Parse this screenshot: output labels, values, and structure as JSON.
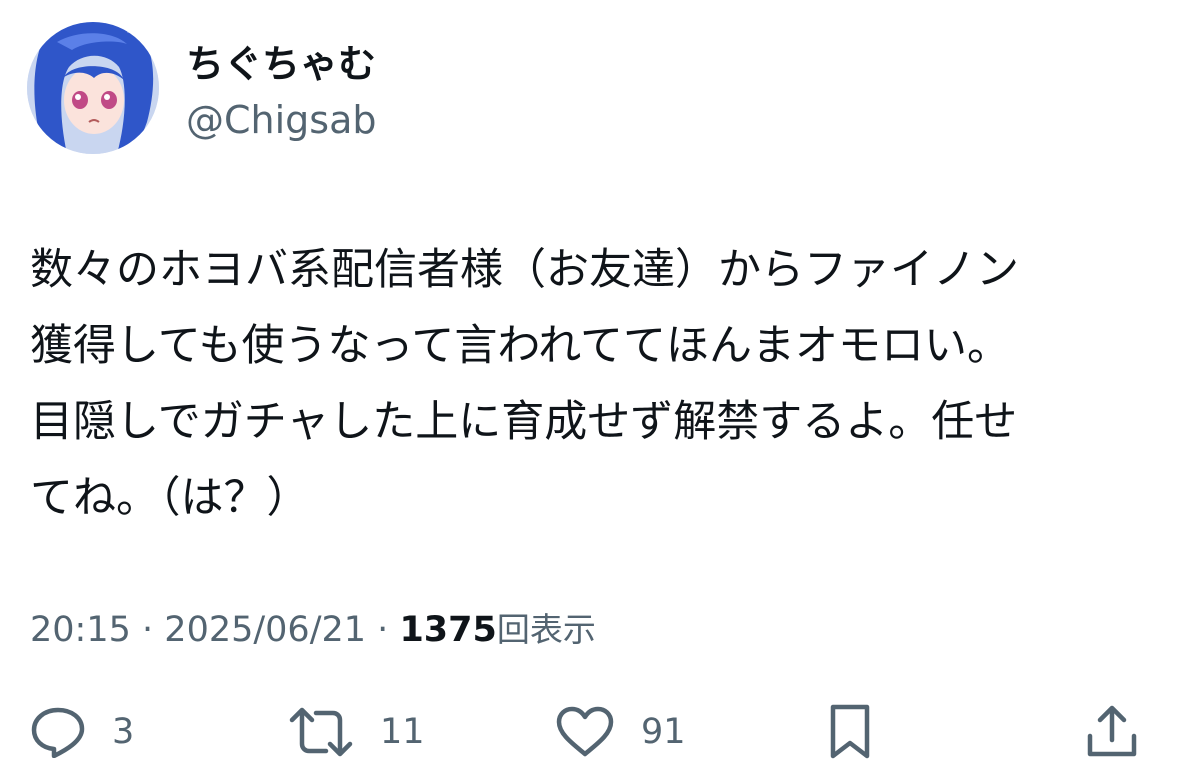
{
  "user": {
    "display_name": "ちぐちゃむ",
    "handle": "@Chigsab"
  },
  "tweet": {
    "lines": [
      "数々のホヨバ系配信者様（お友達）からファイノン",
      "獲得しても使うなって言われててほんまオモロい。",
      "目隠しでガチャした上に育成せず解禁するよ。任せ",
      "てね。（は？）"
    ],
    "time": "20:15",
    "date": "2025/06/21",
    "separator": "·",
    "views": "1375",
    "views_label": "回表示"
  },
  "actions": {
    "reply": {
      "icon": "reply-icon",
      "count": "3"
    },
    "retweet": {
      "icon": "retweet-icon",
      "count": "11"
    },
    "like": {
      "icon": "heart-icon",
      "count": "91"
    },
    "bookmark": {
      "icon": "bookmark-icon"
    },
    "share": {
      "icon": "share-icon"
    }
  },
  "colors": {
    "text": "#0f1419",
    "secondary": "#536471",
    "avatar_hair": "#2f56c9"
  }
}
